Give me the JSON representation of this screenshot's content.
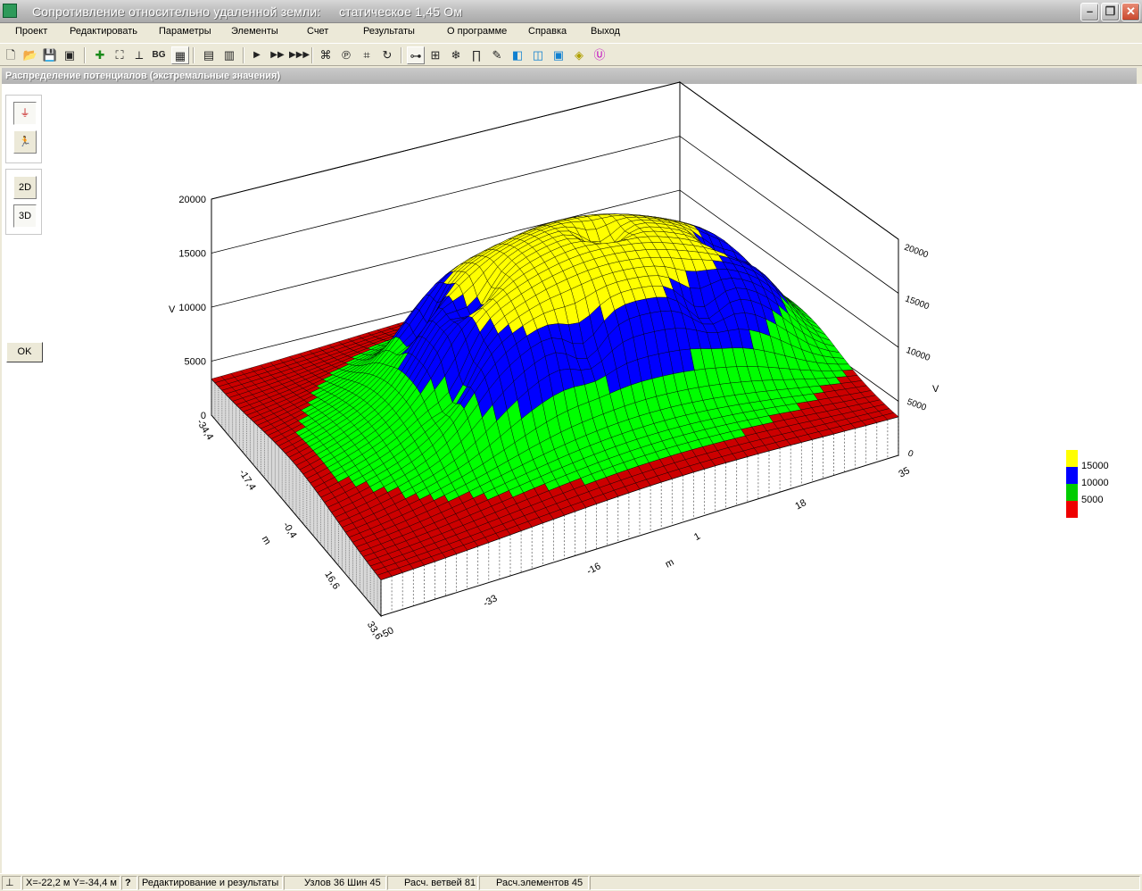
{
  "window": {
    "title": "Сопротивление относительно удаленной земли:     статическое 1,45 Ом"
  },
  "menu": [
    "Проект",
    "Редактировать",
    "Параметры",
    "Элементы",
    "Счет",
    "Результаты",
    "О программе",
    "Справка",
    "Выход"
  ],
  "toolbar_icons": [
    "new-file-icon",
    "open-folder-icon",
    "save-icon",
    "save-as-icon",
    "add-element-icon",
    "select-frame-icon",
    "axes-icon",
    "bg-icon",
    "grid-icon",
    "page-icon",
    "page-preview-icon",
    "play-icon",
    "step-forward-icon",
    "fast-forward-icon",
    "node-icon",
    "branch-icon",
    "node-edit-icon",
    "branch-edit-icon",
    "link-icon",
    "mesh-icon",
    "snowflake-icon",
    "frame-icon",
    "brush-icon",
    "plane-icon",
    "box-icon",
    "cube-icon",
    "probe-icon",
    "voltage-icon"
  ],
  "toolbar": {
    "bg_label": "BG"
  },
  "subwindow": {
    "title": "Распределение потенциалов (экстремальные значения)"
  },
  "side": {
    "btn_2d": "2D",
    "btn_3d": "3D",
    "ok": "OK"
  },
  "chart_data": {
    "type": "surface3d",
    "title": "",
    "zlabel": "V",
    "z_ticks": [
      "0",
      "5000",
      "10000",
      "15000",
      "20000"
    ],
    "x_label": "m",
    "x_ticks": [
      "-50",
      "-33",
      "-16",
      "1",
      "18",
      "35"
    ],
    "y_label": "m",
    "y_ticks": [
      "-34,4",
      "-17,4",
      "-0,4",
      "16,6",
      "33,6"
    ],
    "zlim": [
      0,
      20000
    ],
    "levels": [
      {
        "value": "15000",
        "color": "#ffff00"
      },
      {
        "value": "10000",
        "color": "#0000ff"
      },
      {
        "value": "5000",
        "color": "#00ff00"
      },
      {
        "value": "",
        "color": "#ff0000"
      }
    ]
  },
  "legend": [
    {
      "label": "15000",
      "color": "#ffff00"
    },
    {
      "label": "10000",
      "color": "#0000ff"
    },
    {
      "label": "5000",
      "color": "#00cc00"
    },
    {
      "label": "",
      "color": "#ee0000"
    }
  ],
  "status": {
    "coords": "X=-22,2 м   Y=-34,4 м",
    "help": "?",
    "mode": "Редактирование и результаты",
    "nodes": "Узлов 36 Шин 45",
    "branches": "Расч. ветвей 81",
    "elements": "Расч.элементов 45"
  }
}
